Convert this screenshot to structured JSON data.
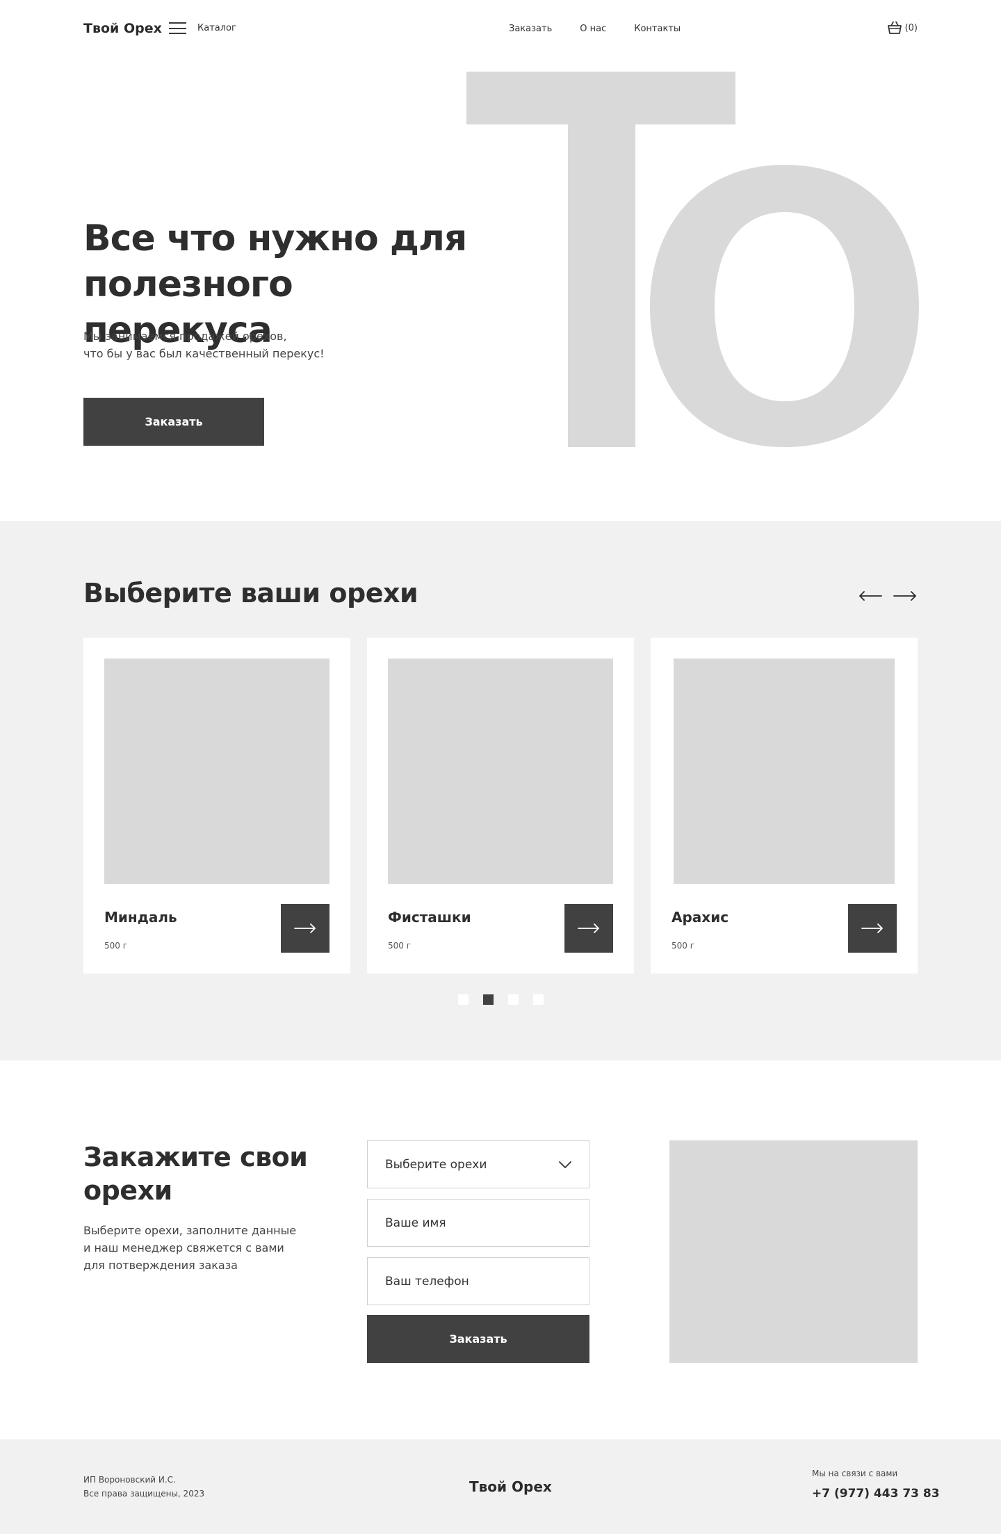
{
  "header": {
    "logo": "Твой Орех",
    "catalog_label": "Каталог",
    "nav": [
      "Заказать",
      "О нас",
      "Контакты"
    ],
    "cart_count": "(0)"
  },
  "hero": {
    "title": "Все что нужно для полезного перекуса",
    "text_line1": "Мы занимаемся продажей орехов,",
    "text_line2": "что бы у вас был качественный перекус!",
    "button": "Заказать",
    "deco_letters": "То"
  },
  "products": {
    "title": "Выберите ваши орехи",
    "items": [
      {
        "name": "Миндаль",
        "weight": "500 г"
      },
      {
        "name": "Фисташки",
        "weight": "500 г"
      },
      {
        "name": "Арахис",
        "weight": "500 г"
      }
    ],
    "dots_total": 4,
    "active_dot": 2
  },
  "order": {
    "title": "Закажите свои орехи",
    "text": "Выберите орехи, заполните данные и наш менеджер свяжется с вами для потверждения заказа",
    "select_placeholder": "Выберите орехи",
    "name_placeholder": "Ваше имя",
    "phone_placeholder": "Ваш телефон",
    "button": "Заказать"
  },
  "footer": {
    "company": "ИП Вороновский И.С.",
    "rights": "Все права защищены, 2023",
    "logo": "Твой Орех",
    "contact_label": "Мы на связи с вами",
    "phone": "+7 (977) 443 73 83"
  },
  "colors": {
    "dark": "#414141",
    "placeholder": "#d9d9d9",
    "section_bg": "#f1f1f1"
  }
}
